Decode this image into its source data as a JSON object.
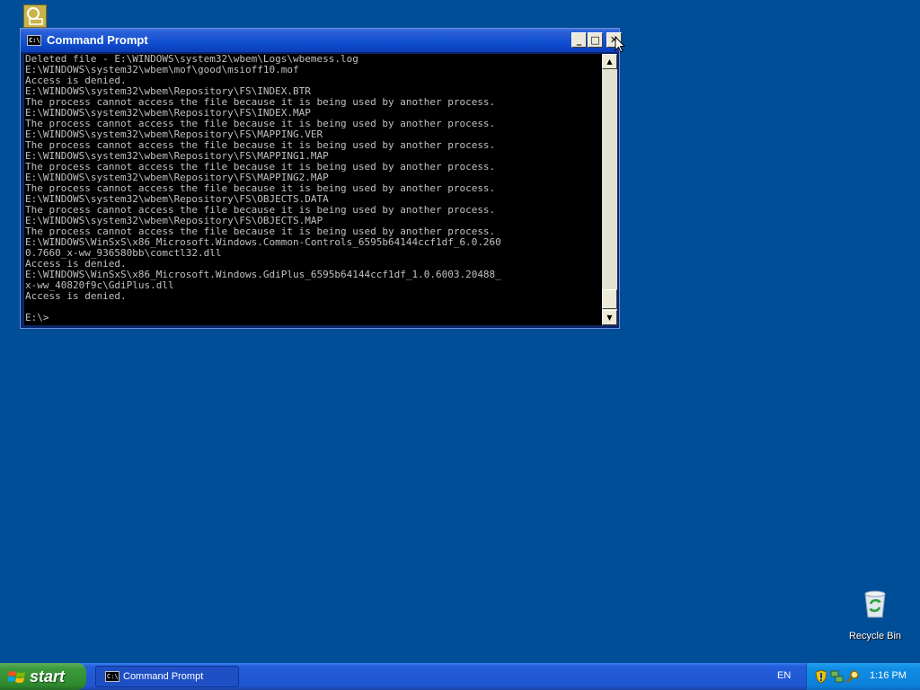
{
  "desktop": {
    "recycle_bin_label": "Recycle Bin"
  },
  "window": {
    "title": "Command Prompt",
    "icon_text": "C:\\",
    "console_lines": [
      "Deleted file - E:\\WINDOWS\\system32\\wbem\\Logs\\wbemess.log",
      "E:\\WINDOWS\\system32\\wbem\\mof\\good\\msioff10.mof",
      "Access is denied.",
      "E:\\WINDOWS\\system32\\wbem\\Repository\\FS\\INDEX.BTR",
      "The process cannot access the file because it is being used by another process.",
      "E:\\WINDOWS\\system32\\wbem\\Repository\\FS\\INDEX.MAP",
      "The process cannot access the file because it is being used by another process.",
      "E:\\WINDOWS\\system32\\wbem\\Repository\\FS\\MAPPING.VER",
      "The process cannot access the file because it is being used by another process.",
      "E:\\WINDOWS\\system32\\wbem\\Repository\\FS\\MAPPING1.MAP",
      "The process cannot access the file because it is being used by another process.",
      "E:\\WINDOWS\\system32\\wbem\\Repository\\FS\\MAPPING2.MAP",
      "The process cannot access the file because it is being used by another process.",
      "E:\\WINDOWS\\system32\\wbem\\Repository\\FS\\OBJECTS.DATA",
      "The process cannot access the file because it is being used by another process.",
      "E:\\WINDOWS\\system32\\wbem\\Repository\\FS\\OBJECTS.MAP",
      "The process cannot access the file because it is being used by another process.",
      "E:\\WINDOWS\\WinSxS\\x86_Microsoft.Windows.Common-Controls_6595b64144ccf1df_6.0.260",
      "0.7660_x-ww_936580bb\\comctl32.dll",
      "Access is denied.",
      "E:\\WINDOWS\\WinSxS\\x86_Microsoft.Windows.GdiPlus_6595b64144ccf1df_1.0.6003.20488_",
      "x-ww_40820f9c\\GdiPlus.dll",
      "Access is denied.",
      "",
      "E:\\>"
    ],
    "scroll_position": 0.92
  },
  "taskbar": {
    "start_label": "start",
    "task_button_label": "Command Prompt",
    "language": "EN",
    "clock": "1:16 PM"
  }
}
